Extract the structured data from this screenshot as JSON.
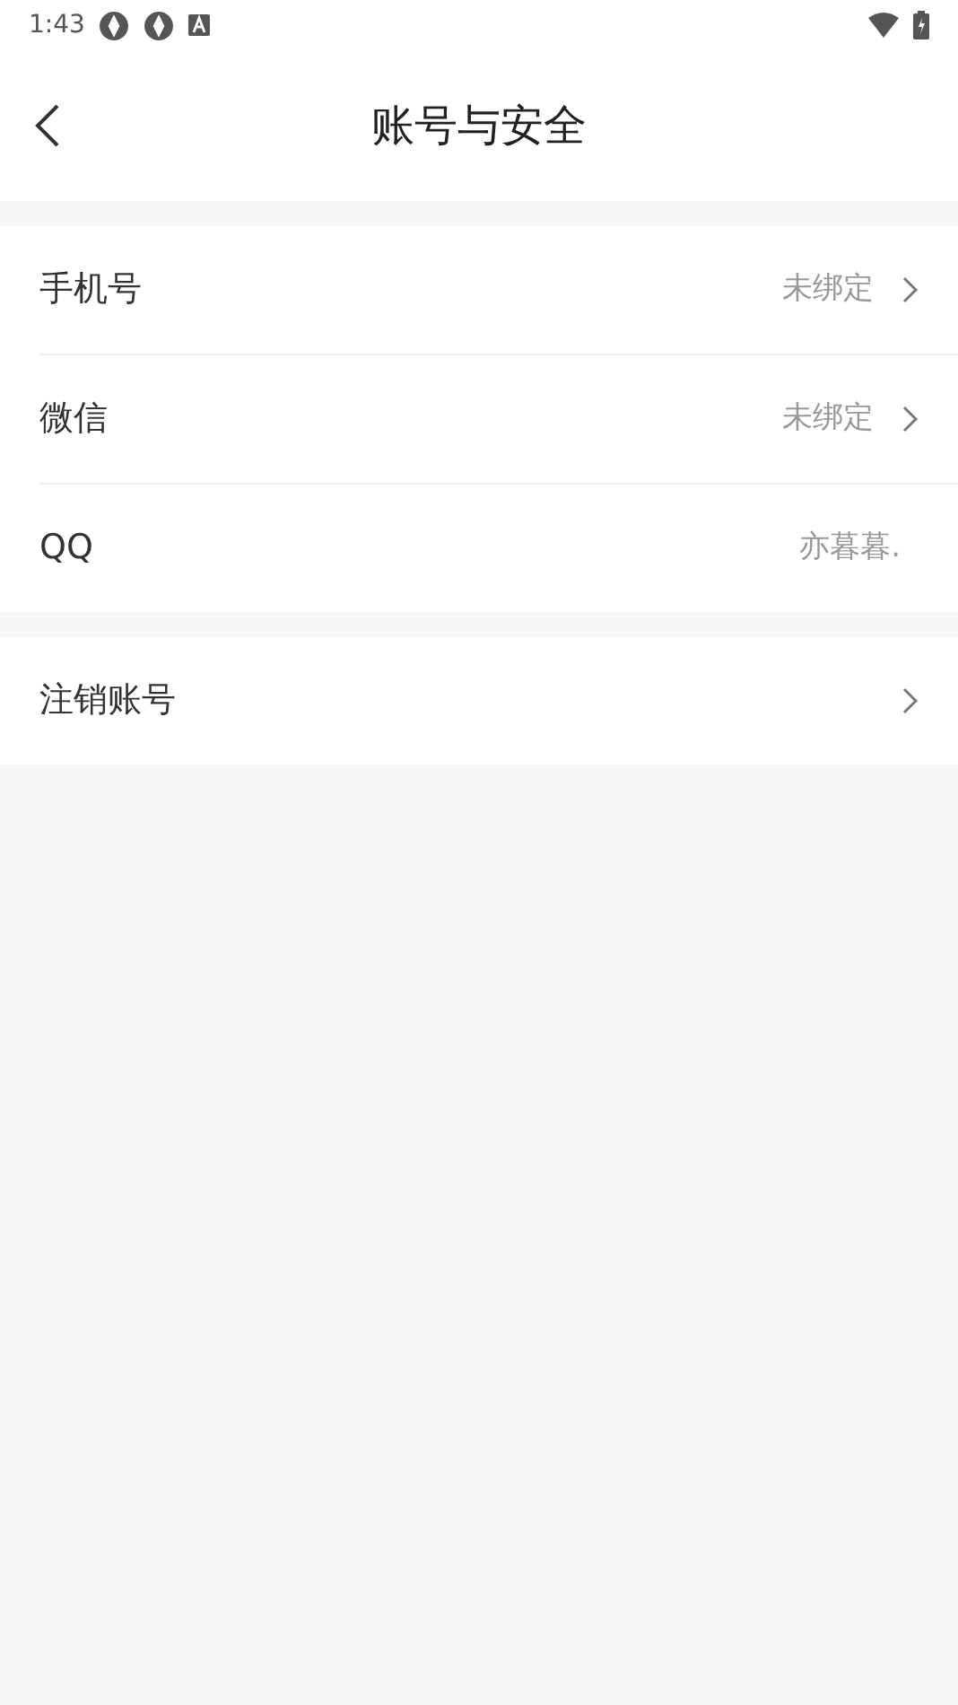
{
  "status_bar": {
    "time": "1:43"
  },
  "header": {
    "title": "账号与安全"
  },
  "groups": [
    {
      "items": [
        {
          "label": "手机号",
          "value": "未绑定",
          "kind": "link"
        },
        {
          "label": "微信",
          "value": "未绑定",
          "kind": "link"
        },
        {
          "label": "QQ",
          "value": "亦暮暮.",
          "kind": "info"
        }
      ]
    },
    {
      "items": [
        {
          "label": "注销账号",
          "kind": "link"
        }
      ]
    }
  ]
}
